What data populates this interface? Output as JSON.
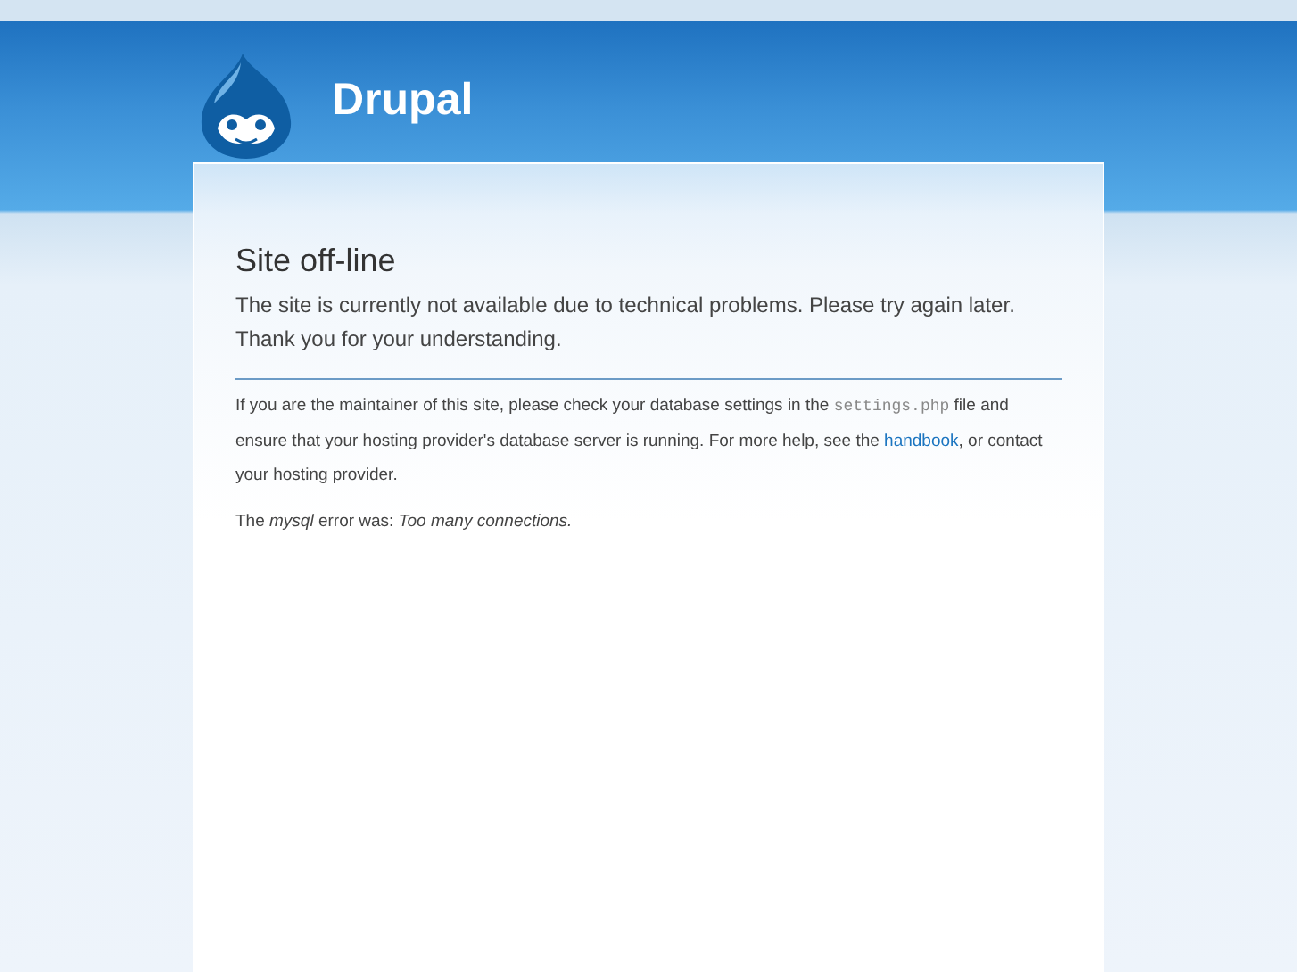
{
  "site": {
    "name": "Drupal"
  },
  "page": {
    "title": "Site off-line",
    "message": "The site is currently not available due to technical problems. Please try again later. Thank you for your understanding.",
    "details": [
      {
        "kind": "text",
        "text": "If you are the maintainer of this site, please check your database settings in the "
      },
      {
        "kind": "code",
        "text": "settings.php"
      },
      {
        "kind": "text",
        "text": " file and ensure that your hosting provider's database server is running. For more help, see the "
      },
      {
        "kind": "link",
        "text": "handbook"
      },
      {
        "kind": "text",
        "text": ", or contact your hosting provider."
      }
    ],
    "error": "The *mysql* error was: *Too many connections.*"
  }
}
